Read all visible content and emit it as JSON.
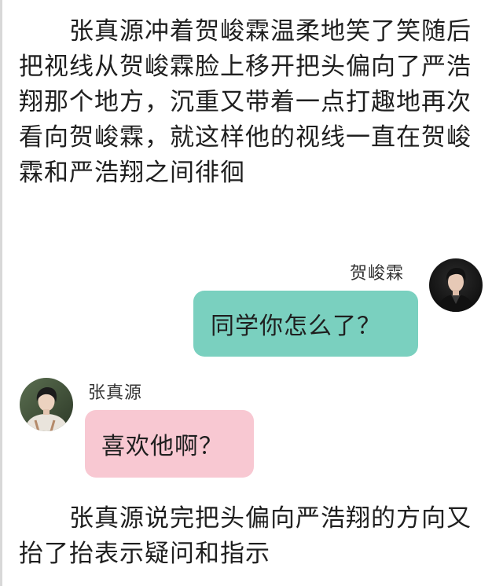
{
  "narration_top": "　　张真源冲着贺峻霖温柔地笑了笑随后把视线从贺峻霖脸上移开把头偏向了严浩翔那个地方，沉重又带着一点打趣地再次看向贺峻霖，就这样他的视线一直在贺峻霖和严浩翔之间徘徊",
  "messages": [
    {
      "side": "right",
      "sender": "贺峻霖",
      "text": "同学你怎么了？",
      "bubble_color": "#7ad0bf"
    },
    {
      "side": "left",
      "sender": "张真源",
      "text": "喜欢他啊？",
      "bubble_color": "#f8c8d2"
    }
  ],
  "narration_bottom": "　　张真源说完把头偏向严浩翔的方向又抬了抬表示疑问和指示"
}
